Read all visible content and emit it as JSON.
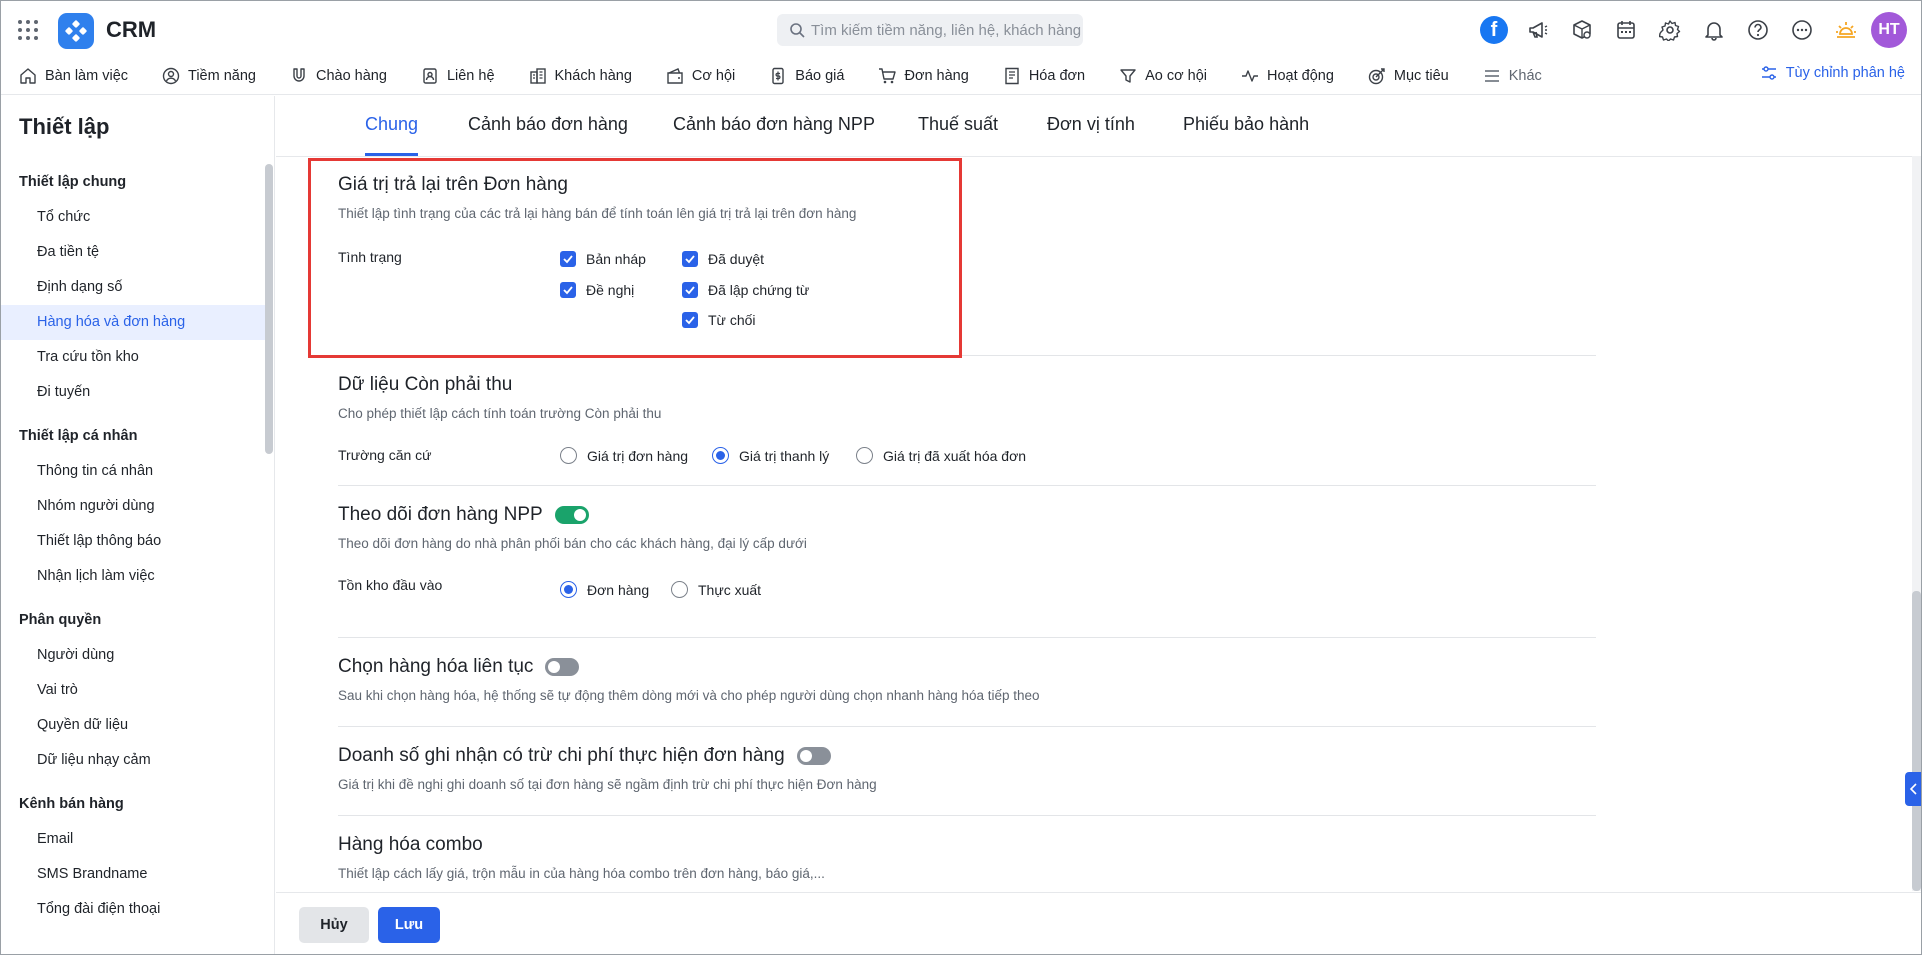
{
  "app": {
    "name": "CRM"
  },
  "search": {
    "placeholder": "Tìm kiếm tiềm năng, liên hệ, khách hàng"
  },
  "avatar": {
    "initials": "HT"
  },
  "nav": {
    "items": [
      {
        "label": "Bàn làm việc",
        "icon": "home-icon"
      },
      {
        "label": "Tiềm năng",
        "icon": "user-icon"
      },
      {
        "label": "Chào hàng",
        "icon": "magnet-icon"
      },
      {
        "label": "Liên hệ",
        "icon": "contact-icon"
      },
      {
        "label": "Khách hàng",
        "icon": "building-icon"
      },
      {
        "label": "Cơ hội",
        "icon": "wallet-icon"
      },
      {
        "label": "Báo giá",
        "icon": "quote-icon"
      },
      {
        "label": "Đơn hàng",
        "icon": "cart-icon"
      },
      {
        "label": "Hóa đơn",
        "icon": "invoice-icon"
      },
      {
        "label": "Ao cơ hội",
        "icon": "funnel-icon"
      },
      {
        "label": "Hoạt động",
        "icon": "activity-icon"
      },
      {
        "label": "Mục tiêu",
        "icon": "target-icon"
      }
    ],
    "more_label": "Khác",
    "customize_label": "Tùy chỉnh phân hệ"
  },
  "sidebar": {
    "title": "Thiết lập",
    "groups": [
      {
        "label": "Thiết lập chung",
        "items": [
          "Tổ chức",
          "Đa tiền tệ",
          "Định dạng số",
          "Hàng hóa và đơn hàng",
          "Tra cứu tồn kho",
          "Đi tuyến"
        ]
      },
      {
        "label": "Thiết lập cá nhân",
        "items": [
          "Thông tin cá nhân",
          "Nhóm người dùng",
          "Thiết lập thông báo",
          "Nhận lịch làm việc"
        ]
      },
      {
        "label": "Phân quyền",
        "items": [
          "Người dùng",
          "Vai trò",
          "Quyền dữ liệu",
          "Dữ liệu nhạy cảm"
        ]
      },
      {
        "label": "Kênh bán hàng",
        "items": [
          "Email",
          "SMS Brandname",
          "Tổng đài điện thoại"
        ]
      }
    ]
  },
  "tabs": [
    "Chung",
    "Cảnh báo đơn hàng",
    "Cảnh báo đơn hàng NPP",
    "Thuế suất",
    "Đơn vị tính",
    "Phiếu bảo hành"
  ],
  "sections": {
    "return_value": {
      "title": "Giá trị trả lại trên Đơn hàng",
      "desc": "Thiết lập tình trạng của các trả lại hàng bán để tính toán lên giá trị trả lại trên đơn hàng",
      "field_label": "Tình trạng",
      "options": [
        {
          "label": "Bản nháp",
          "checked": true
        },
        {
          "label": "Đã duyệt",
          "checked": true
        },
        {
          "label": "Đề nghị",
          "checked": true
        },
        {
          "label": "Đã lập chứng từ",
          "checked": true
        },
        {
          "label": "Từ chối",
          "checked": true
        }
      ]
    },
    "receivable": {
      "title": "Dữ liệu Còn phải thu",
      "desc": "Cho phép thiết lập cách tính toán trường Còn phải thu",
      "field_label": "Trường căn cứ",
      "options": [
        "Giá trị đơn hàng",
        "Giá trị thanh lý",
        "Giá trị đã xuất hóa đơn"
      ],
      "selected": "Giá trị thanh lý"
    },
    "npp_tracking": {
      "title": "Theo dõi đơn hàng NPP",
      "enabled": true,
      "desc": "Theo dõi đơn hàng do nhà phân phối bán cho các khách hàng, đại lý cấp dưới",
      "field_label": "Tồn kho đầu vào",
      "options": [
        "Đơn hàng",
        "Thực xuất"
      ],
      "selected": "Đơn hàng"
    },
    "continuous_select": {
      "title": "Chọn hàng hóa liên tục",
      "enabled": false,
      "desc": "Sau khi chọn hàng hóa, hệ thống sẽ tự động thêm dòng mới và cho phép người dùng chọn nhanh hàng hóa tiếp theo"
    },
    "revenue_cost": {
      "title": "Doanh số ghi nhận có trừ chi phí thực hiện đơn hàng",
      "enabled": false,
      "desc": "Giá trị khi đề nghị ghi doanh số tại đơn hàng sẽ ngầm định trừ chi phí thực hiện Đơn hàng"
    },
    "combo": {
      "title": "Hàng hóa combo",
      "desc": "Thiết lập cách lấy giá, trộn mẫu in của hàng hóa combo trên đơn hàng, báo giá,..."
    }
  },
  "footer": {
    "cancel_label": "Hủy",
    "save_label": "Lưu"
  },
  "colors": {
    "accent": "#2a62e8",
    "toggle_on": "#1aa36b",
    "highlight": "#e53935"
  }
}
